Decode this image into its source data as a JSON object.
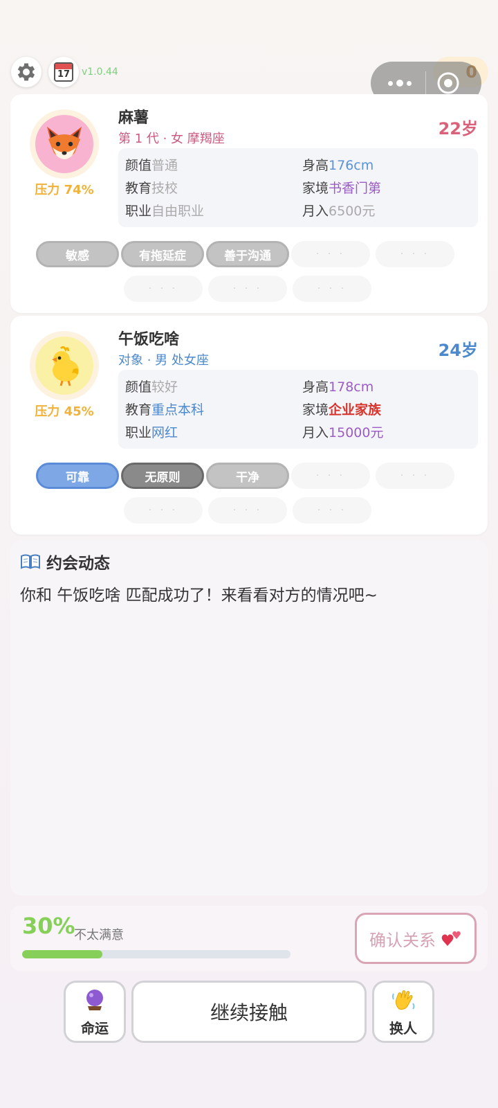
{
  "topbar": {
    "version": "v1.0.44",
    "coins": "0",
    "calendar_day": "17"
  },
  "player": {
    "name": "麻薯",
    "subtitle": "第 1 代 · 女 摩羯座",
    "age": "22岁",
    "pressure": "压力 74%",
    "stats": {
      "looks_label": "颜值",
      "looks": "普通",
      "height_label": "身高",
      "height": "176cm",
      "edu_label": "教育",
      "edu": "技校",
      "family_label": "家境",
      "family": "书香门第",
      "job_label": "职业",
      "job": "自由职业",
      "income_label": "月入",
      "income": "6500元"
    },
    "tags": [
      "敏感",
      "有拖延症",
      "善于沟通"
    ],
    "empty_tag": "· · ·"
  },
  "partner": {
    "name": "午饭吃啥",
    "subtitle": "对象 · 男 处女座",
    "age": "24岁",
    "pressure": "压力 45%",
    "stats": {
      "looks_label": "颜值",
      "looks": "较好",
      "height_label": "身高",
      "height": "178cm",
      "edu_label": "教育",
      "edu": "重点本科",
      "family_label": "家境",
      "family": "企业家族",
      "job_label": "职业",
      "job": "网红",
      "income_label": "月入",
      "income": "15000元"
    },
    "tags": [
      "可靠",
      "无原则",
      "干净"
    ],
    "empty_tag": "· · ·"
  },
  "feed": {
    "title": "约会动态",
    "message": "你和 午饭吃啥 匹配成功了！来看看对方的情况吧~"
  },
  "progress": {
    "percent_label": "30%",
    "value": 0.3,
    "status": "不太满意",
    "confirm_label": "确认关系"
  },
  "actions": {
    "fate_label": "命运",
    "continue_label": "继续接触",
    "swap_label": "换人"
  },
  "colors": {
    "female": "#c95c7e",
    "male": "#4c88cc",
    "pressure": "#f0b23a",
    "progress": "#86d05a"
  }
}
